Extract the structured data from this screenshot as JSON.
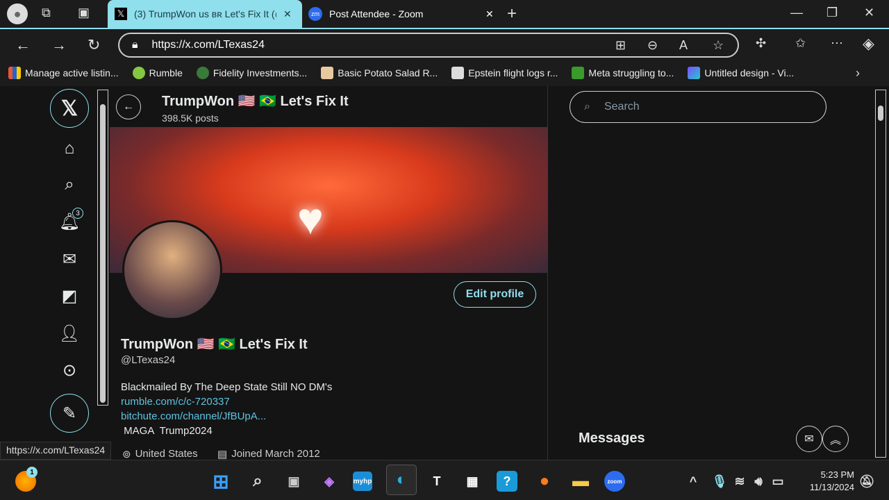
{
  "browser": {
    "tabs": [
      {
        "label": "(3) TrumpWon us ʙʀ Let's Fix It (@",
        "active": true
      },
      {
        "label": "Post Attendee - Zoom",
        "active": false
      }
    ],
    "url": "https://x.com/LTexas24",
    "bookmarks": [
      {
        "label": "Manage active listin..."
      },
      {
        "label": "Rumble"
      },
      {
        "label": "Fidelity Investments..."
      },
      {
        "label": "Basic Potato Salad R..."
      },
      {
        "label": "Epstein flight logs r..."
      },
      {
        "label": "Meta struggling to..."
      },
      {
        "label": "Untitled design - Vi..."
      }
    ],
    "status_url": "https://x.com/LTexas24",
    "accent": "#8fdfec"
  },
  "x": {
    "nav": {
      "notifications_badge": "3"
    },
    "header": {
      "name": "TrumpWon 🇺🇸 🇧🇷 Let's Fix It",
      "posts": "398.5K posts"
    },
    "profile": {
      "name": "TrumpWon 🇺🇸 🇧🇷 Let's Fix It",
      "handle": "@LTexas24",
      "edit_label": "Edit profile",
      "bio": "Blackmailed By The Deep State Still  NO DM's",
      "link1": "rumble.com/c/c-720337",
      "link2": "bitchute.com/channel/JfBUpA...",
      "tags": " MAGA  Trump2024",
      "location": "United States",
      "joined": "Joined March 2012"
    },
    "search_placeholder": "Search",
    "messages_title": "Messages"
  },
  "taskbar": {
    "widget_badge": "1",
    "time": "5:23 PM",
    "date": "11/13/2024"
  }
}
